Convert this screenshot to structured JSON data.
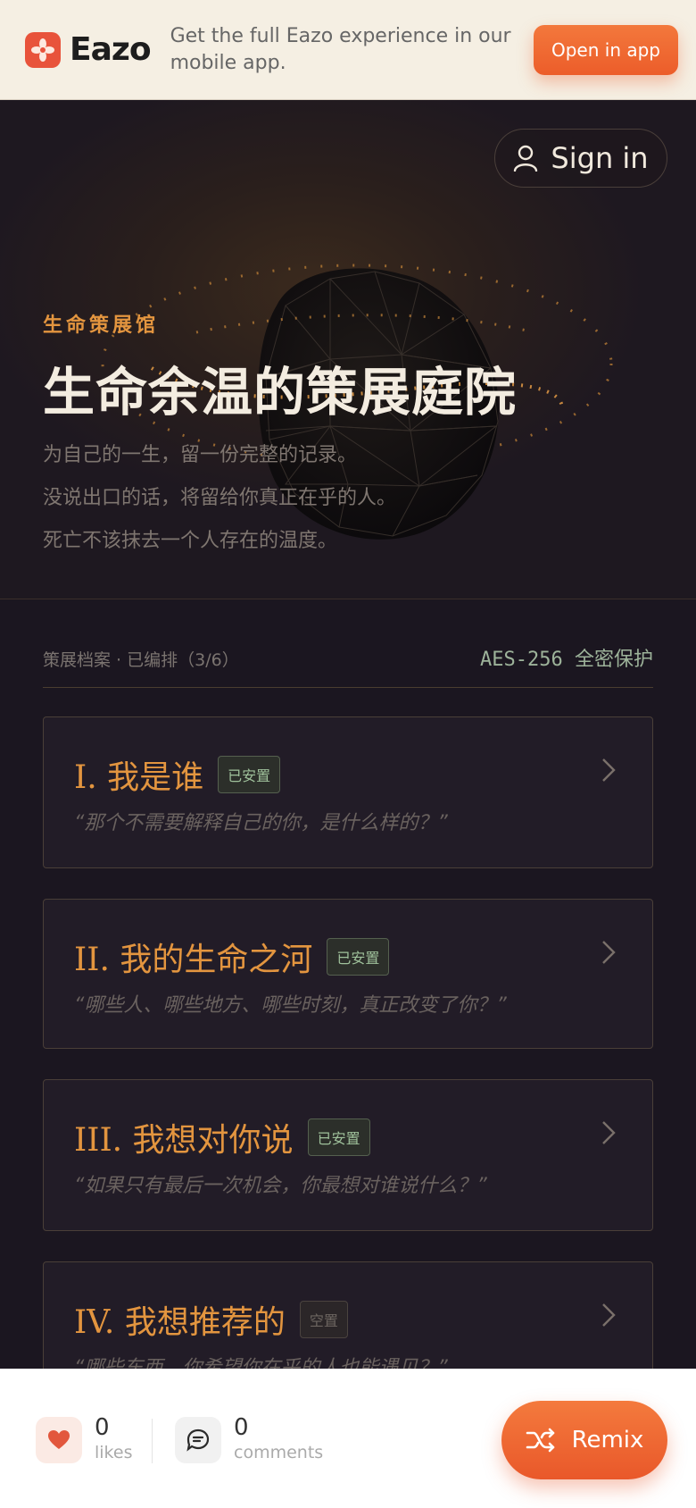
{
  "banner": {
    "brand_name": "Eazo",
    "message": "Get the full Eazo experience in our mobile app.",
    "open_app_label": "Open in app",
    "brand_color": "#e8533b"
  },
  "hero": {
    "signin_label": "Sign in",
    "eyebrow": "生命策展馆",
    "title": "生命余温的策展庭院",
    "lines": [
      "为自己的一生，留一份完整的记录。",
      "没说出口的话，将留给你真正在乎的人。",
      "死亡不该抹去一个人存在的温度。"
    ]
  },
  "archive": {
    "label": "策展档案 · 已编排（3/6）",
    "security": "AES-256 全密保护",
    "cards": [
      {
        "title": "I. 我是谁",
        "badge": "已安置",
        "status": "placed",
        "quote": "“那个不需要解释自己的你，是什么样的？”"
      },
      {
        "title": "II. 我的生命之河",
        "badge": "已安置",
        "status": "placed",
        "quote": "“哪些人、哪些地方、哪些时刻，真正改变了你？”"
      },
      {
        "title": "III. 我想对你说",
        "badge": "已安置",
        "status": "placed",
        "quote": "“如果只有最后一次机会，你最想对谁说什么？”"
      },
      {
        "title": "IV. 我想推荐的",
        "badge": "空置",
        "status": "empty",
        "quote": "“哪些东西，你希望你在乎的人也能遇见？”"
      }
    ]
  },
  "bottom": {
    "likes_count": "0",
    "likes_label": "likes",
    "comments_count": "0",
    "comments_label": "comments",
    "remix_label": "Remix",
    "accent_color": "#ec5d2a"
  },
  "icons": [
    "eazo-logo-icon",
    "user-icon",
    "chevron-right-icon",
    "heart-icon",
    "comment-icon",
    "shuffle-icon"
  ]
}
